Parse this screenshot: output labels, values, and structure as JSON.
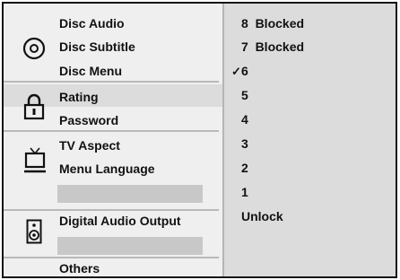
{
  "menu": {
    "disc": {
      "icon": "disc-icon",
      "items": [
        "Disc Audio",
        "Disc Subtitle",
        "Disc Menu"
      ]
    },
    "rating": {
      "icon": "lock-icon",
      "items": [
        "Rating",
        "Password"
      ],
      "selected": "Rating"
    },
    "tv": {
      "icon": "tv-icon",
      "items": [
        "TV Aspect",
        "Menu Language"
      ]
    },
    "audio": {
      "icon": "speaker-icon",
      "items": [
        "Digital Audio Output"
      ]
    },
    "others": {
      "label": "Others"
    }
  },
  "rating_options": {
    "items": [
      "8  Blocked",
      "7  Blocked",
      "6",
      "5",
      "4",
      "3",
      "2",
      "1",
      "Unlock"
    ],
    "checked": "6",
    "check_mark": "✓"
  },
  "colors": {
    "panel": "#efefef",
    "highlight": "#dcdcdc",
    "placeholder": "#c8c8c8",
    "text": "#111111"
  }
}
